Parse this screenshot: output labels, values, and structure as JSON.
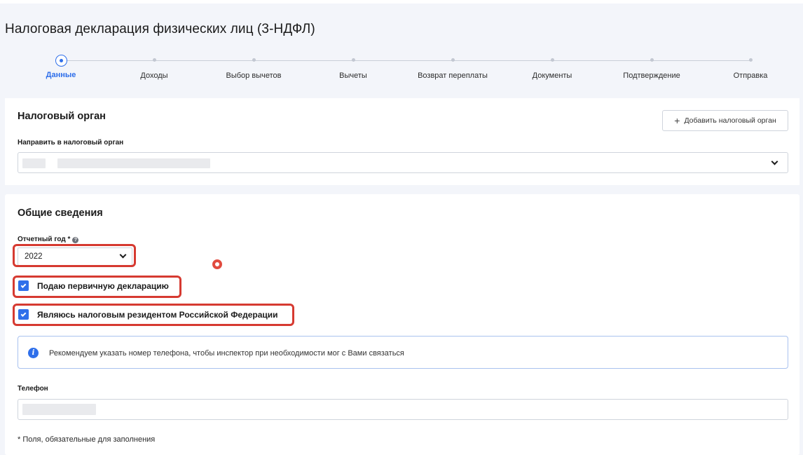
{
  "page": {
    "title": "Налоговая декларация физических лиц (3-НДФЛ)"
  },
  "stepper": {
    "active_index": 0,
    "steps": [
      {
        "label": "Данные"
      },
      {
        "label": "Доходы"
      },
      {
        "label": "Выбор вычетов"
      },
      {
        "label": "Вычеты"
      },
      {
        "label": "Возврат переплаты"
      },
      {
        "label": "Документы"
      },
      {
        "label": "Подтверждение"
      },
      {
        "label": "Отправка"
      }
    ]
  },
  "tax_office": {
    "title": "Налоговый орган",
    "add_button_label": "Добавить налоговый орган",
    "field_label": "Направить в налоговый орган",
    "value": ""
  },
  "general": {
    "title": "Общие сведения",
    "year_label": "Отчетный год *",
    "year_value": "2022",
    "primary_declaration": {
      "label": "Подаю первичную декларацию",
      "checked": true
    },
    "tax_resident": {
      "label": "Являюсь налоговым резидентом Российской Федерации",
      "checked": true
    },
    "info_text": "Рекомендуем указать номер телефона, чтобы инспектор при необходимости мог с Вами связаться",
    "phone_label": "Телефон",
    "phone_value": "",
    "footnote": "* Поля, обязательные для заполнения"
  },
  "colors": {
    "accent": "#2f6fea",
    "highlight": "#d63a31",
    "background": "#f3f5fa"
  }
}
